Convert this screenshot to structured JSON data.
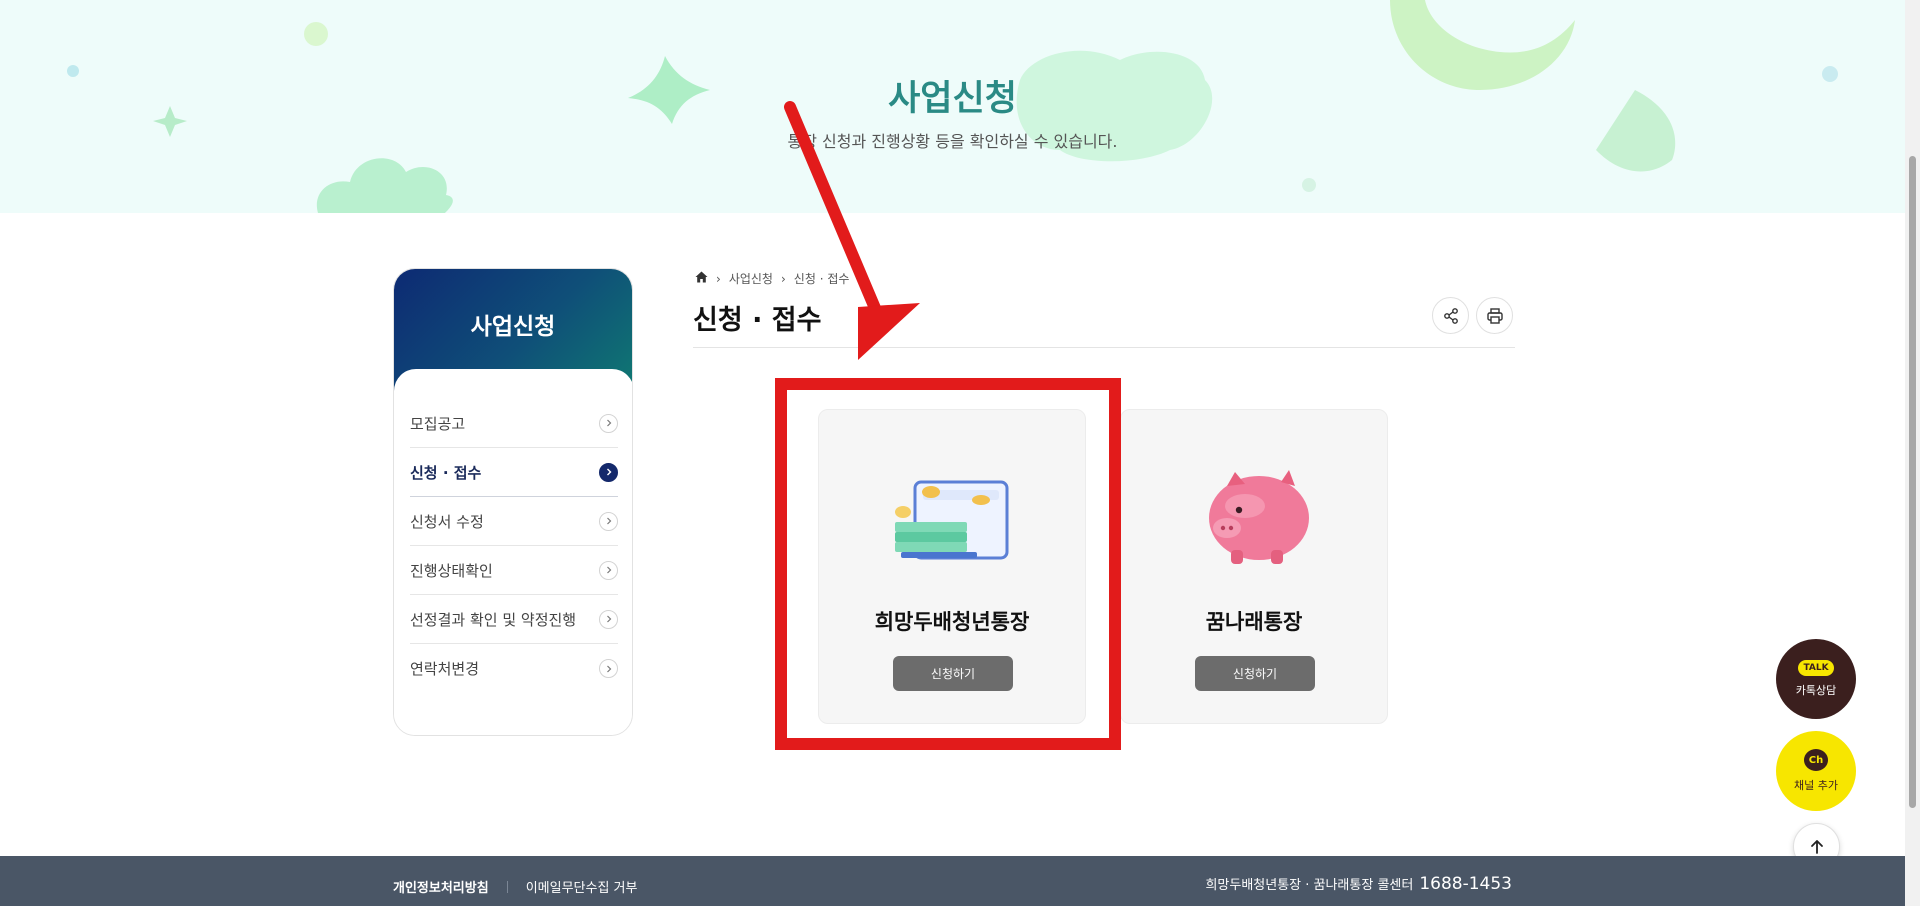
{
  "hero": {
    "title": "사업신청",
    "subtitle": "통장 신청과 진행상황 등을 확인하실 수 있습니다."
  },
  "sidebar": {
    "title": "사업신청",
    "items": [
      {
        "label": "모집공고",
        "active": false
      },
      {
        "label": "신청 · 접수",
        "active": true
      },
      {
        "label": "신청서 수정",
        "active": false
      },
      {
        "label": "진행상태확인",
        "active": false
      },
      {
        "label": "선정결과 확인 및 약정진행",
        "active": false
      },
      {
        "label": "연락처변경",
        "active": false
      }
    ]
  },
  "breadcrumb": {
    "home_icon": "home-icon",
    "items": [
      "사업신청",
      "신청 · 접수"
    ]
  },
  "page": {
    "title": "신청 · 접수",
    "tools": [
      "share-icon",
      "print-icon"
    ]
  },
  "cards": [
    {
      "name": "희망두배청년통장",
      "button": "신청하기",
      "icon": "wallet-money-icon"
    },
    {
      "name": "꿈나래통장",
      "button": "신청하기",
      "icon": "piggy-bank-icon"
    }
  ],
  "floating": {
    "talk_badge": "TALK",
    "talk_label": "카톡상담",
    "channel_badge": "Ch",
    "channel_label": "채널 추가",
    "top_icon": "arrow-up-icon"
  },
  "footer": {
    "links": [
      "개인정보처리방침",
      "이메일무단수집 거부"
    ],
    "contact_text": "희망두배청년통장 · 꿈나래통장 콜센터",
    "phone": "1688-1453"
  },
  "colors": {
    "hero_bg": "#eefcfa",
    "hero_title": "#2a8a85",
    "sidebar_active": "#14296b",
    "annotation_red": "#e21b1b",
    "kakao_brown": "#3b1f1e",
    "kakao_yellow": "#f7e600",
    "footer_bg": "#4a5666"
  }
}
